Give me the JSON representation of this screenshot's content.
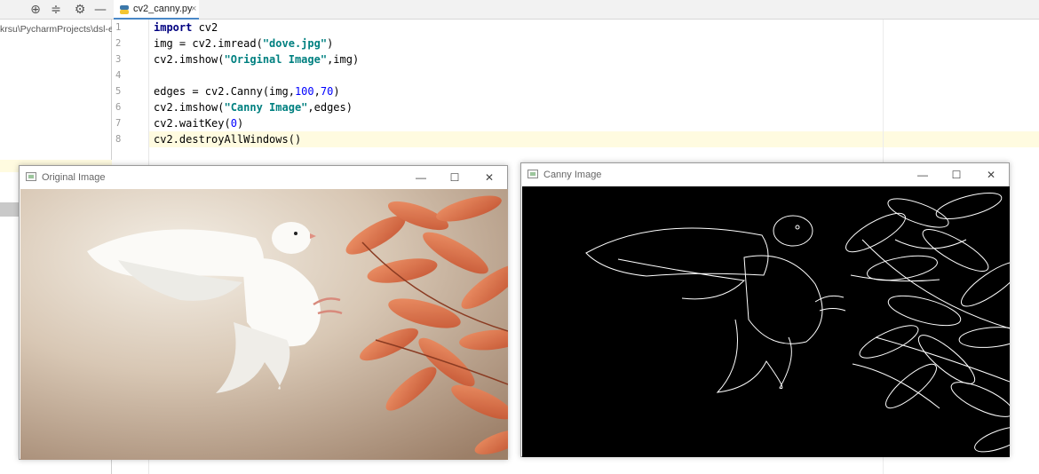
{
  "project_pane": {
    "path_text": "krsu\\PycharmProjects\\dsl-e"
  },
  "toolbar_icons": [
    "crosshair-icon",
    "collapse-icon",
    "gear-icon",
    "minimize-icon"
  ],
  "editor": {
    "tab": {
      "label": "cv2_canny.py",
      "close": "×"
    },
    "line_numbers": [
      "1",
      "2",
      "3",
      "4",
      "5",
      "6",
      "7",
      "8"
    ],
    "lines": [
      {
        "kw": "import",
        "rest": " cv2"
      },
      {
        "a": "img = cv2.imread(",
        "s": "\"dove.jpg\"",
        "b": ")"
      },
      {
        "a": "cv2.imshow(",
        "s": "\"Original Image\"",
        "b": ",img)"
      },
      {
        "empty": ""
      },
      {
        "a": "edges = cv2.Canny(img,",
        "n1": "100",
        "c": ",",
        "n2": "70",
        "b": ")"
      },
      {
        "a": "cv2.imshow(",
        "s": "\"Canny Image\"",
        "b": ",edges)"
      },
      {
        "a": "cv2.waitKey(",
        "n1": "0",
        "b": ")"
      },
      {
        "a": "cv2.destroyAllWindows()"
      }
    ]
  },
  "windows": {
    "original": {
      "title": "Original Image",
      "min": "—",
      "max": "☐",
      "close": "✕"
    },
    "canny": {
      "title": "Canny Image",
      "min": "—",
      "max": "☐",
      "close": "✕"
    }
  },
  "colors": {
    "keyword": "#000080",
    "string": "#008080",
    "number": "#0000ff",
    "caret_line": "#fffbe0",
    "canny_bg": "#000000"
  }
}
